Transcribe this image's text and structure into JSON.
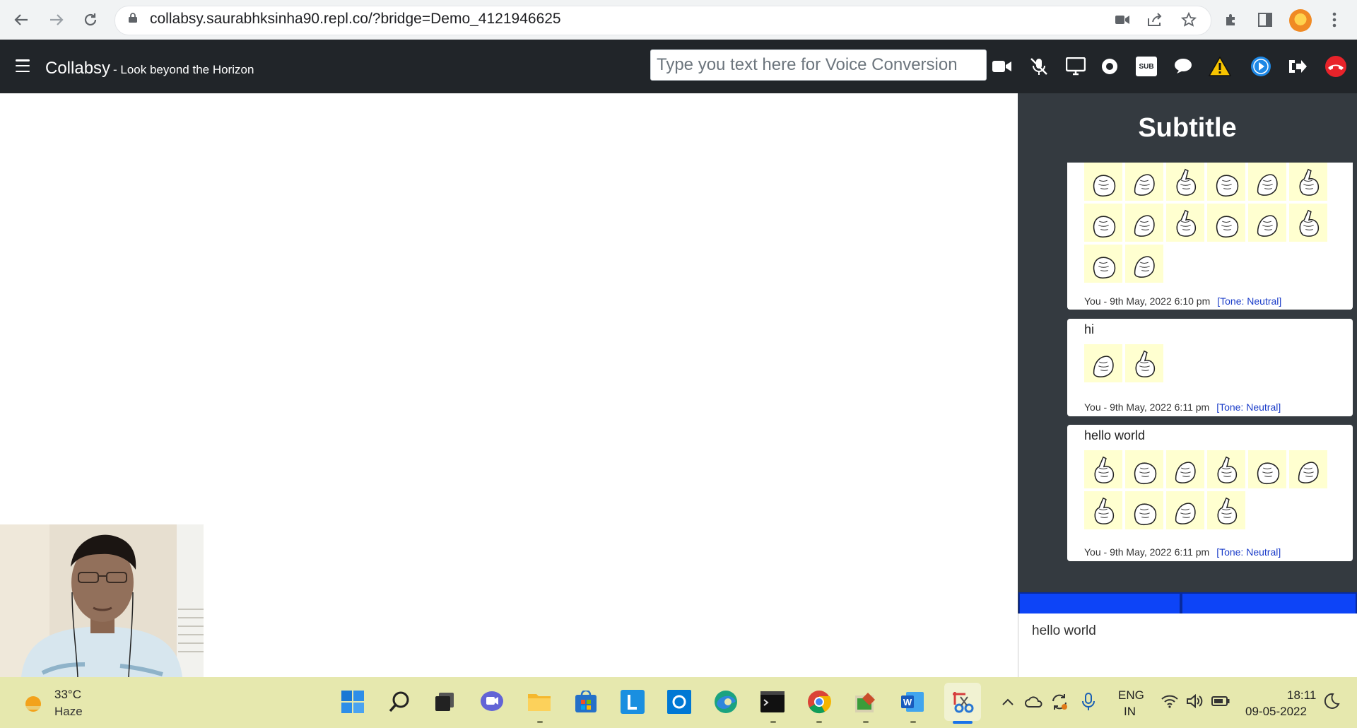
{
  "browser": {
    "url": "collabsy.saurabhksinha90.repl.co/?bridge=Demo_4121946625",
    "icons": [
      "back-arrow-icon",
      "forward-arrow-icon",
      "reload-icon",
      "lock-icon",
      "camera-icon",
      "share-icon",
      "star-icon",
      "extensions-icon",
      "side-panel-icon",
      "profile-avatar",
      "menu-dots-icon"
    ]
  },
  "app": {
    "brand": "Collabsy",
    "tagline": "- Look beyond the Horizon",
    "voice_placeholder": "Type you text here for Voice Conversion",
    "toolbar_icons": [
      "video-camera-icon",
      "mic-muted-icon",
      "screen-share-icon",
      "record-icon",
      "subtitles-icon",
      "chat-icon",
      "warning-icon",
      "play-icon",
      "exit-icon",
      "end-call-icon"
    ],
    "toolbar_sub_label": "SUB"
  },
  "subtitle_panel": {
    "title": "Subtitle",
    "messages": [
      {
        "text": "",
        "sign_count": 14,
        "author": "You - 9th May, 2022 6:10 pm",
        "tone": "[Tone: Neutral]"
      },
      {
        "text": "hi",
        "sign_count": 2,
        "author": "You - 9th May, 2022 6:11 pm",
        "tone": "[Tone: Neutral]"
      },
      {
        "text": "hello world",
        "sign_count": 10,
        "author": "You - 9th May, 2022 6:11 pm",
        "tone": "[Tone: Neutral]"
      }
    ],
    "input_value": "hello world"
  },
  "taskbar": {
    "weather_temp": "33°C",
    "weather_cond": "Haze",
    "lang_line1": "ENG",
    "lang_line2": "IN",
    "time": "18:11",
    "date": "09-05-2022",
    "colors": {
      "background": "#e6e8ae",
      "navbar": "#212529",
      "panel": "#343a40",
      "accent_blue": "#0d44f7"
    }
  }
}
